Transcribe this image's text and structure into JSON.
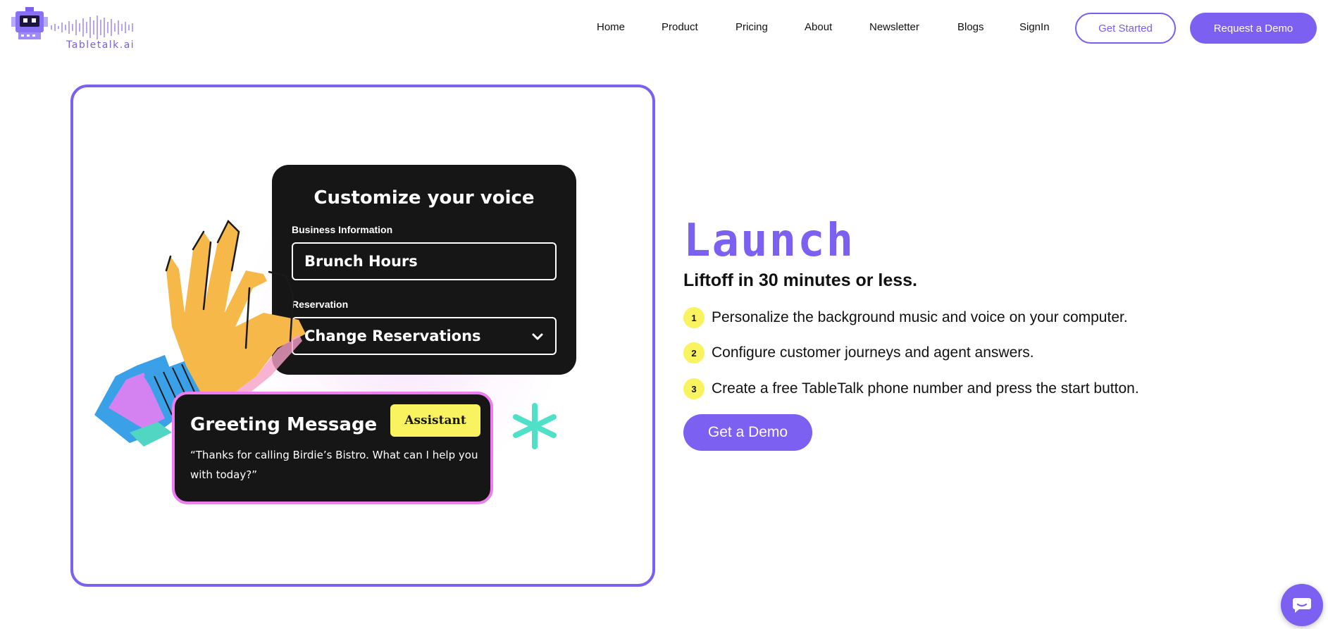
{
  "brand": {
    "name": "Tabletalk.ai",
    "accent_color": "#7b60f2",
    "logo_icon": "robot-icon"
  },
  "nav": {
    "items": [
      {
        "label": "Home"
      },
      {
        "label": "Product"
      },
      {
        "label": "Pricing"
      },
      {
        "label": "About"
      },
      {
        "label": "Newsletter"
      },
      {
        "label": "Blogs"
      },
      {
        "label": "SignIn"
      }
    ],
    "get_started_label": "Get Started",
    "request_demo_label": "Request a Demo"
  },
  "illustration": {
    "voice_title": "Customize your voice",
    "business_label": "Business Information",
    "business_value": "Brunch Hours",
    "reservation_label": "Reservation",
    "reservation_value": "Change Reservations",
    "greeting_title": "Greeting Message",
    "assistant_badge": "Assistant",
    "greeting_quote": "“Thanks for calling Birdie’s Bistro. What can I help you with today?”",
    "badge_color": "#f8f35e",
    "greeting_border_color": "#f07cf2"
  },
  "section": {
    "title": "Launch",
    "subtitle": "Liftoff in 30 minutes or less.",
    "steps": [
      {
        "num": "1",
        "text": "Personalize the background music and voice on your computer."
      },
      {
        "num": "2",
        "text": "Configure customer journeys and agent answers."
      },
      {
        "num": "3",
        "text": "Create a free TableTalk phone number and press the start button."
      }
    ],
    "cta_label": "Get a Demo"
  },
  "chat": {
    "icon": "chat-icon"
  }
}
